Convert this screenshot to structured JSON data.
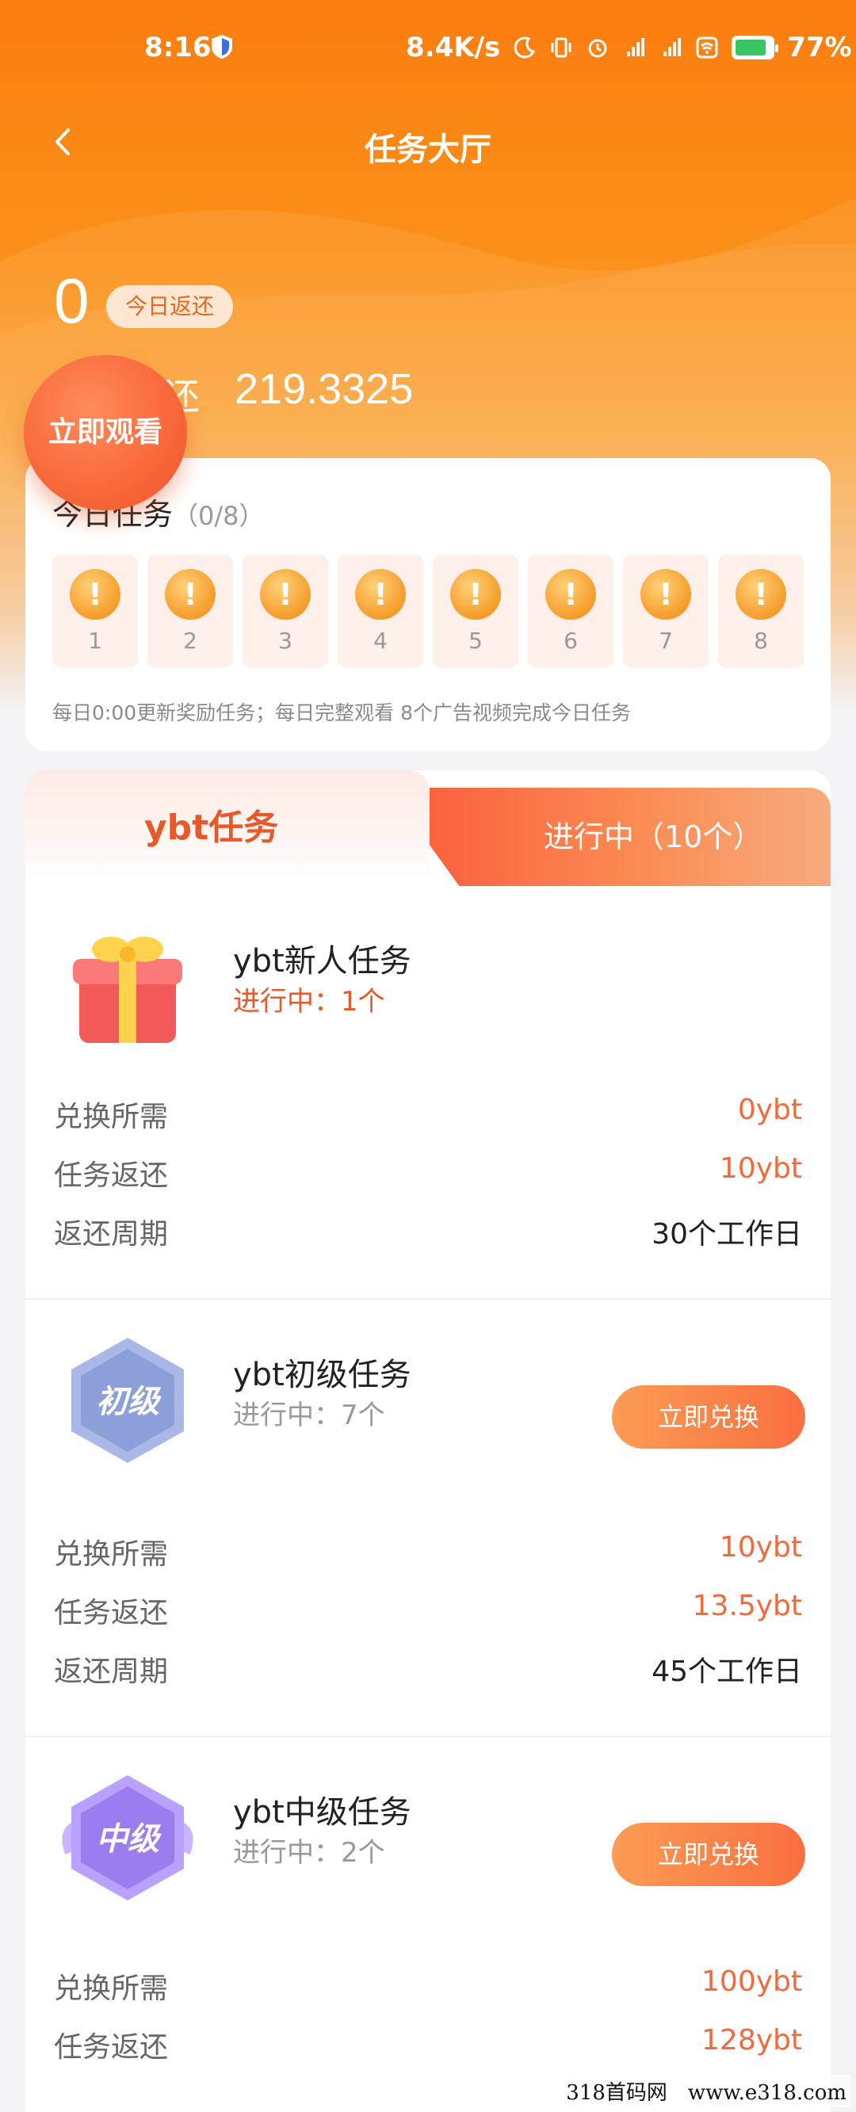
{
  "status_bar": {
    "time": "8:16",
    "speed": "8.4K/s",
    "battery": "77%",
    "icons": [
      "shield-icon",
      "moon-icon",
      "vibrate-icon",
      "alarm-icon",
      "signal-hd-icon",
      "signal-hd-icon",
      "wifi-icon",
      "battery-icon"
    ]
  },
  "header": {
    "title": "任务大厅",
    "back_icon": "chevron-left-icon"
  },
  "summary": {
    "today_amount": "0",
    "today_label": "今日返还",
    "total_label": "累计返还",
    "total_value": "219.3325"
  },
  "watch_button": "立即观看",
  "daily_tasks": {
    "title": "今日任务",
    "count": "（0/8）",
    "items": [
      "1",
      "2",
      "3",
      "4",
      "5",
      "6",
      "7",
      "8"
    ],
    "note": "每日0:00更新奖励任务；每日完整观看 8个广告视频完成今日任务"
  },
  "tabs": {
    "left": "ybt任务",
    "right": "进行中（10个）"
  },
  "tasks": [
    {
      "name": "ybt新人任务",
      "status": "进行中：1个",
      "badge": "gift-icon",
      "rows": [
        {
          "k": "兑换所需",
          "v": "0ybt"
        },
        {
          "k": "任务返还",
          "v": "10ybt"
        },
        {
          "k": "返还周期",
          "v": "30个工作日"
        }
      ]
    },
    {
      "name": "ybt初级任务",
      "status": "进行中：7个",
      "badge_text": "初级",
      "button": "立即兑换",
      "rows": [
        {
          "k": "兑换所需",
          "v": "10ybt"
        },
        {
          "k": "任务返还",
          "v": "13.5ybt"
        },
        {
          "k": "返还周期",
          "v": "45个工作日"
        }
      ]
    },
    {
      "name": "ybt中级任务",
      "status": "进行中：2个",
      "badge_text": "中级",
      "button": "立即兑换",
      "rows": [
        {
          "k": "兑换所需",
          "v": "100ybt"
        },
        {
          "k": "任务返还",
          "v": "128ybt"
        }
      ]
    }
  ],
  "watermark": "318首码网　www.e318.com",
  "colors": {
    "brand_orange": "#fb7d10",
    "accent": "#f06a3c",
    "badge_blue": "#8c9fd8",
    "badge_purple": "#9b7df0"
  }
}
